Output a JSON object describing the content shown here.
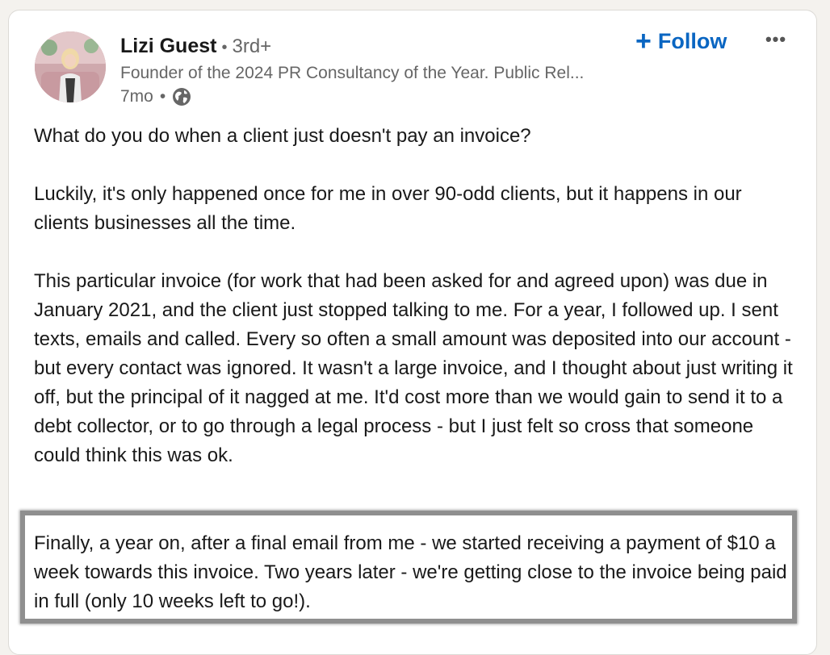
{
  "post": {
    "author": {
      "name": "Lizi Guest",
      "separator": "•",
      "degree": "3rd+",
      "headline": "Founder of the 2024 PR Consultancy of the Year. Public Rel...",
      "time": "7mo",
      "time_separator": "•",
      "visibility_icon": "globe-icon"
    },
    "actions": {
      "follow_icon": "+",
      "follow_label": "Follow",
      "more_label": "•••"
    },
    "paragraphs": [
      "What do you do when a client just doesn't pay an invoice?",
      "Luckily, it's only happened once for me in over 90-odd clients, but it happens in our clients businesses all the time.",
      "This particular invoice (for work that had been asked for and agreed upon) was due in January 2021, and the client just stopped talking to me. For a year, I followed up. I sent texts, emails and called. Every so often a small amount was deposited into our account - but every contact was ignored. It wasn't a large invoice, and I thought about just writing it off, but the principal of it nagged at me. It'd cost more than we would gain to send it to a debt collector, or to go through a legal process - but I just felt so cross that someone could think this was ok."
    ],
    "highlighted_paragraph": "Finally, a year on, after a final email from me - we started receiving a payment of $10 a week towards this invoice. Two years later - we're getting close to the invoice being paid in full (only 10 weeks left to go!)."
  },
  "colors": {
    "accent": "#0a66c2",
    "text": "#191919",
    "muted": "#666666",
    "highlight_border": "#8f8f8f",
    "background": "#f4f2ee"
  }
}
